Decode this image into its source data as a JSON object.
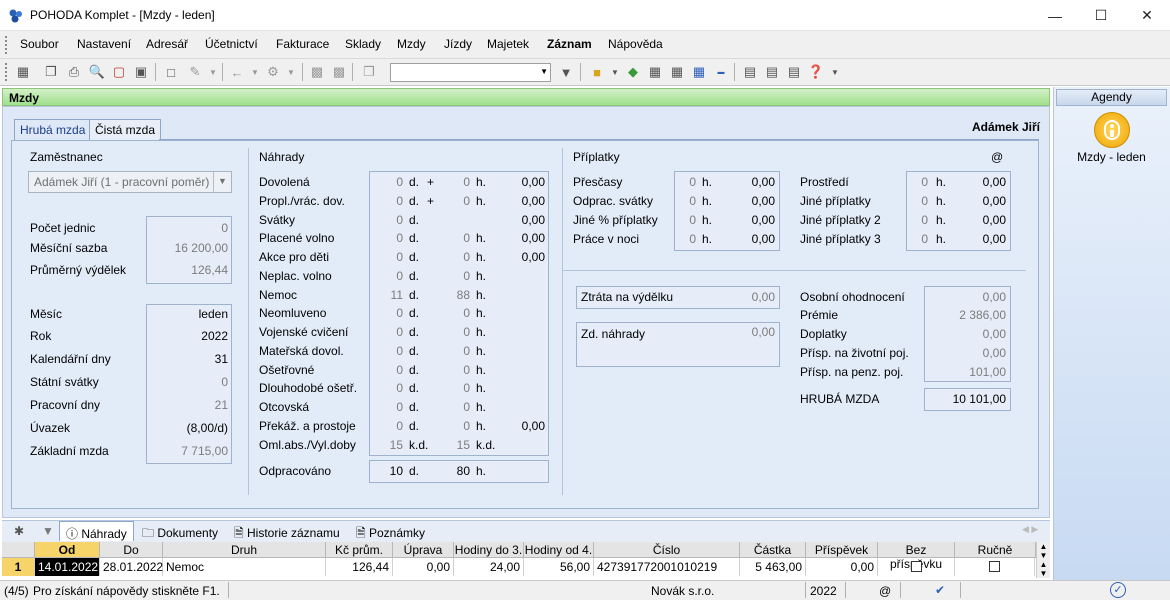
{
  "window": {
    "title": "POHODA Komplet - [Mzdy - leden]"
  },
  "menu": [
    "Soubor",
    "Nastavení",
    "Adresář",
    "Účetnictví",
    "Fakturace",
    "Sklady",
    "Mzdy",
    "Jízdy",
    "Majetek",
    "Záznam",
    "Nápověda"
  ],
  "module": {
    "title": "Mzdy"
  },
  "tabs": {
    "gross": "Hrubá mzda",
    "net": "Čistá mzda"
  },
  "employee_name": "Adámek Jiří",
  "employee": {
    "group": "Zaměstnanec",
    "combo": "Adámek Jiří (1 - pracovní poměr)",
    "rows1": [
      {
        "label": "Počet jednic",
        "value": "0"
      },
      {
        "label": "Měsíční sazba",
        "value": "16 200,00"
      },
      {
        "label": "Průměrný výdělek",
        "value": "126,44"
      }
    ],
    "rows2": [
      {
        "label": "Měsíc",
        "value": "leden"
      },
      {
        "label": "Rok",
        "value": "2022"
      },
      {
        "label": "Kalendářní dny",
        "value": "31"
      },
      {
        "label": "Státní svátky",
        "value": "0"
      },
      {
        "label": "Pracovní dny",
        "value": "21"
      },
      {
        "label": "Úvazek",
        "value": "(8,00/d)"
      },
      {
        "label": "Základní mzda",
        "value": "7 715,00"
      }
    ]
  },
  "nahrady": {
    "group": "Náhrady",
    "rows": [
      {
        "label": "Dovolená",
        "d": "0",
        "du": "d.",
        "plus": "+",
        "h": "0",
        "hu": "h.",
        "amt": "0,00"
      },
      {
        "label": "Propl./vrác. dov.",
        "d": "0",
        "du": "d.",
        "plus": "+",
        "h": "0",
        "hu": "h.",
        "amt": "0,00"
      },
      {
        "label": "Svátky",
        "d": "0",
        "du": "d.",
        "plus": "",
        "h": "",
        "hu": "",
        "amt": "0,00"
      },
      {
        "label": "Placené volno",
        "d": "0",
        "du": "d.",
        "plus": "",
        "h": "0",
        "hu": "h.",
        "amt": "0,00"
      },
      {
        "label": "Akce pro děti",
        "d": "0",
        "du": "d.",
        "plus": "",
        "h": "0",
        "hu": "h.",
        "amt": "0,00"
      },
      {
        "label": "Neplac. volno",
        "d": "0",
        "du": "d.",
        "plus": "",
        "h": "0",
        "hu": "h.",
        "amt": ""
      },
      {
        "label": "Nemoc",
        "d": "11",
        "du": "d.",
        "plus": "",
        "h": "88",
        "hu": "h.",
        "amt": ""
      },
      {
        "label": "Neomluveno",
        "d": "0",
        "du": "d.",
        "plus": "",
        "h": "0",
        "hu": "h.",
        "amt": ""
      },
      {
        "label": "Vojenské cvičení",
        "d": "0",
        "du": "d.",
        "plus": "",
        "h": "0",
        "hu": "h.",
        "amt": ""
      },
      {
        "label": "Mateřská dovol.",
        "d": "0",
        "du": "d.",
        "plus": "",
        "h": "0",
        "hu": "h.",
        "amt": ""
      },
      {
        "label": "Ošetřovné",
        "d": "0",
        "du": "d.",
        "plus": "",
        "h": "0",
        "hu": "h.",
        "amt": ""
      },
      {
        "label": "Dlouhodobé ošetř.",
        "d": "0",
        "du": "d.",
        "plus": "",
        "h": "0",
        "hu": "h.",
        "amt": ""
      },
      {
        "label": "Otcovská",
        "d": "0",
        "du": "d.",
        "plus": "",
        "h": "0",
        "hu": "h.",
        "amt": ""
      },
      {
        "label": "Překáž. a prostoje",
        "d": "0",
        "du": "d.",
        "plus": "",
        "h": "0",
        "hu": "h.",
        "amt": "0,00"
      },
      {
        "label": "Oml.abs./Vyl.doby",
        "d": "15",
        "du": "k.d.",
        "plus": "",
        "h": "15",
        "hu": "k.d.",
        "amt": ""
      }
    ],
    "odpracovano": {
      "label": "Odpracováno",
      "d": "10",
      "du": "d.",
      "h": "80",
      "hu": "h."
    }
  },
  "priplatky": {
    "group": "Příplatky",
    "at": "@",
    "left": [
      {
        "label": "Přesčasy",
        "h": "0",
        "hu": "h.",
        "amt": "0,00"
      },
      {
        "label": "Odprac. svátky",
        "h": "0",
        "hu": "h.",
        "amt": "0,00"
      },
      {
        "label": "Jiné % příplatky",
        "h": "0",
        "hu": "h.",
        "amt": "0,00"
      },
      {
        "label": "Práce v noci",
        "h": "0",
        "hu": "h.",
        "amt": "0,00"
      }
    ],
    "right": [
      {
        "label": "Prostředí",
        "h": "0",
        "hu": "h.",
        "amt": "0,00"
      },
      {
        "label": "Jiné příplatky",
        "h": "0",
        "hu": "h.",
        "amt": "0,00"
      },
      {
        "label": "Jiné příplatky 2",
        "h": "0",
        "hu": "h.",
        "amt": "0,00"
      },
      {
        "label": "Jiné příplatky 3",
        "h": "0",
        "hu": "h.",
        "amt": "0,00"
      }
    ]
  },
  "ztrata": {
    "label": "Ztráta na výdělku",
    "value": "0,00"
  },
  "zdnahrady": {
    "label": "Zd. náhrady",
    "value": "0,00"
  },
  "totals": {
    "rows": [
      {
        "label": "Osobní ohodnocení",
        "value": "0,00"
      },
      {
        "label": "Prémie",
        "value": "2 386,00"
      },
      {
        "label": "Doplatky",
        "value": "0,00"
      },
      {
        "label": "Přísp. na životní poj.",
        "value": "0,00"
      },
      {
        "label": "Přísp. na penz. poj.",
        "value": "101,00"
      }
    ],
    "gross": {
      "label": "HRUBÁ MZDA",
      "value": "10 101,00"
    }
  },
  "side": {
    "header": "Agendy",
    "item": "Mzdy - leden"
  },
  "bottom_tabs": [
    "Náhrady",
    "Dokumenty",
    "Historie záznamu",
    "Poznámky"
  ],
  "grid": {
    "headers": [
      "Od",
      "Do",
      "Druh",
      "Kč prům.",
      "Úprava",
      "Hodiny do 3.",
      "Hodiny od 4.",
      "Číslo",
      "Částka",
      "Příspěvek",
      "Bez příspěvku",
      "Ručně"
    ],
    "row": {
      "num": "1",
      "od": "14.01.2022",
      "do": "28.01.2022",
      "druh": "Nemoc",
      "kc": "126,44",
      "uprava": "0,00",
      "h3": "24,00",
      "h4": "56,00",
      "cislo": "427391772001010219",
      "castka": "5 463,00",
      "prispevek": "0,00"
    }
  },
  "status": {
    "page": "(4/5)",
    "help": "Pro získání nápovědy stiskněte F1.",
    "company": "Novák s.r.o.",
    "year": "2022",
    "at": "@"
  }
}
